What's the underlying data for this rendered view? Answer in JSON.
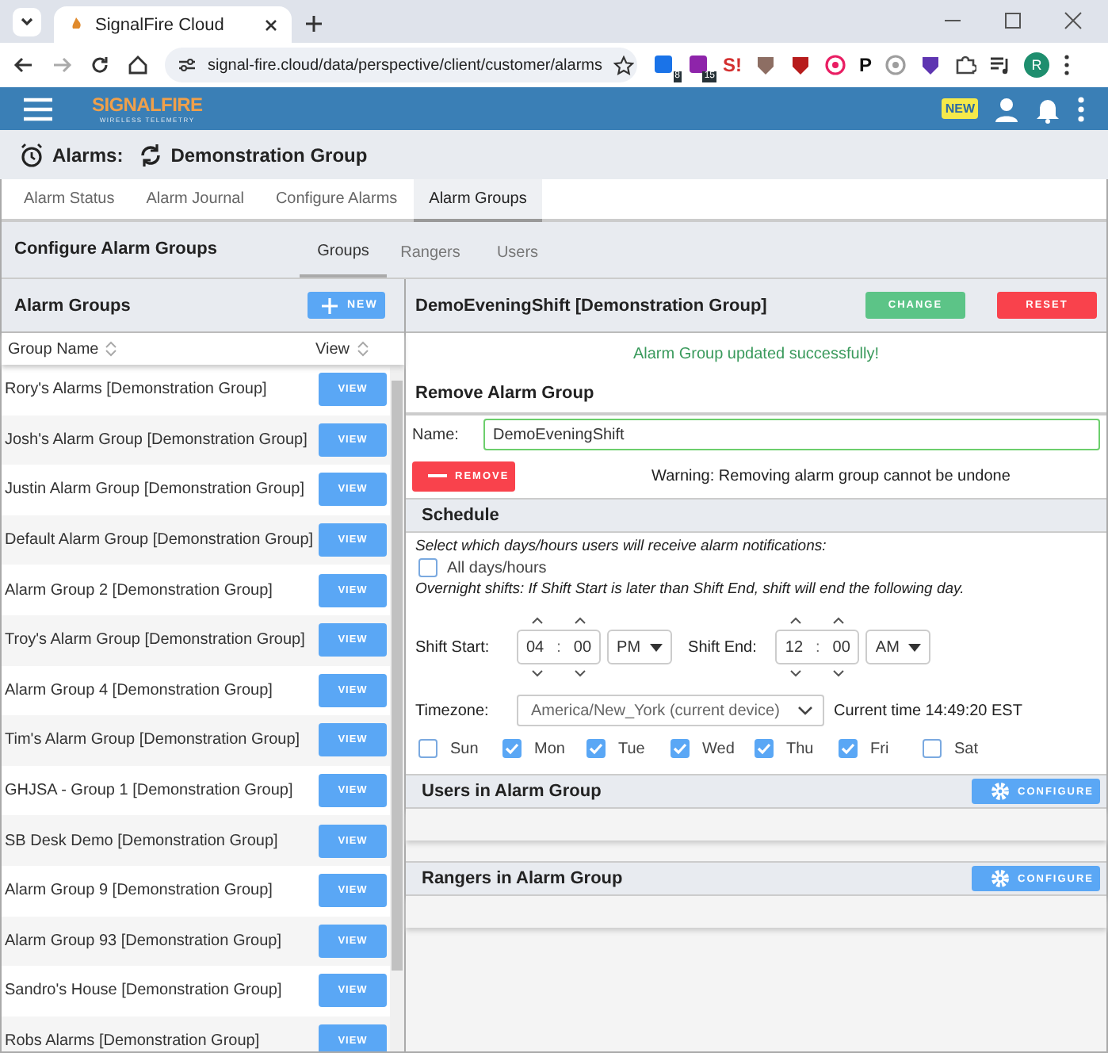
{
  "browser": {
    "tab_title": "SignalFire Cloud",
    "url": "signal-fire.cloud/data/perspective/client/customer/alarms",
    "extensions": [
      {
        "kind": "badge",
        "text": "8",
        "color": "#1a73e8"
      },
      {
        "kind": "badge",
        "text": "15",
        "color": "#8e24aa"
      },
      {
        "kind": "text",
        "text": "S!",
        "color": "#d32f2f"
      },
      {
        "kind": "shape",
        "color": "#8d6e63"
      },
      {
        "kind": "shape",
        "color": "#b71c1c"
      },
      {
        "kind": "circle",
        "color": "#e91e63"
      },
      {
        "kind": "text",
        "text": "P",
        "color": "#111111"
      },
      {
        "kind": "circle",
        "color": "#9e9e9e"
      },
      {
        "kind": "shape",
        "color": "#5e35b1"
      },
      {
        "kind": "puzzle",
        "color": "#444444"
      }
    ],
    "avatar": "R"
  },
  "app": {
    "logo": "SIGNALFIRE",
    "tagline": "WIRELESS TELEMETRY",
    "new_badge": "NEW"
  },
  "page_title": {
    "label": "Alarms:",
    "group": "Demonstration Group"
  },
  "tabs": [
    {
      "label": "Alarm Status",
      "selected": false
    },
    {
      "label": "Alarm Journal",
      "selected": false
    },
    {
      "label": "Configure Alarms",
      "selected": false
    },
    {
      "label": "Alarm Groups",
      "selected": true
    }
  ],
  "section_title": "Configure Alarm Groups",
  "subtabs": [
    {
      "label": "Groups",
      "selected": true
    },
    {
      "label": "Rangers",
      "selected": false
    },
    {
      "label": "Users",
      "selected": false
    }
  ],
  "left": {
    "title": "Alarm Groups",
    "new_button": "NEW",
    "columns": [
      "Group Name",
      "View"
    ],
    "rows": [
      {
        "name": "Rory's Alarms [Demonstration Group]",
        "button": "VIEW"
      },
      {
        "name": "Josh's Alarm Group [Demonstration Group]",
        "button": "VIEW"
      },
      {
        "name": "Justin Alarm Group [Demonstration Group]",
        "button": "VIEW"
      },
      {
        "name": "Default Alarm Group [Demonstration Group]",
        "button": "VIEW"
      },
      {
        "name": "Alarm Group 2 [Demonstration Group]",
        "button": "VIEW"
      },
      {
        "name": "Troy's Alarm Group [Demonstration Group]",
        "button": "VIEW"
      },
      {
        "name": "Alarm Group 4 [Demonstration Group]",
        "button": "VIEW"
      },
      {
        "name": "Tim's Alarm Group [Demonstration Group]",
        "button": "VIEW"
      },
      {
        "name": "GHJSA - Group 1 [Demonstration Group]",
        "button": "VIEW"
      },
      {
        "name": "SB Desk Demo [Demonstration Group]",
        "button": "VIEW"
      },
      {
        "name": "Alarm Group 9 [Demonstration Group]",
        "button": "VIEW"
      },
      {
        "name": "Alarm Group 93 [Demonstration Group]",
        "button": "VIEW"
      },
      {
        "name": "Sandro's House [Demonstration Group]",
        "button": "VIEW"
      },
      {
        "name": "Robs Alarms [Demonstration Group]",
        "button": "VIEW"
      }
    ]
  },
  "detail": {
    "title": "DemoEveningShift [Demonstration Group]",
    "change_button": "CHANGE",
    "reset_button": "RESET",
    "message": "Alarm Group updated successfully!",
    "remove_title": "Remove Alarm Group",
    "name_label": "Name:",
    "name_value": "DemoEveningShift",
    "remove_button": "REMOVE",
    "warning": "Warning: Removing alarm group cannot be undone",
    "schedule": {
      "title": "Schedule",
      "intro": "Select which days/hours users will receive alarm notifications:",
      "all_days": {
        "label": "All days/hours",
        "checked": false
      },
      "note": "Overnight shifts: If Shift Start is later than Shift End, shift will end the following day.",
      "start": {
        "label": "Shift Start:",
        "hour": "04",
        "separator": ":",
        "minute": "00",
        "ampm": "PM"
      },
      "end": {
        "label": "Shift End:",
        "hour": "12",
        "separator": ":",
        "minute": "00",
        "ampm": "AM"
      },
      "timezone_label": "Timezone:",
      "timezone": "America/New_York (current device)",
      "current_time": "Current time 14:49:20 EST",
      "days": [
        {
          "label": "Sun",
          "checked": false
        },
        {
          "label": "Mon",
          "checked": true
        },
        {
          "label": "Tue",
          "checked": true
        },
        {
          "label": "Wed",
          "checked": true
        },
        {
          "label": "Thu",
          "checked": true
        },
        {
          "label": "Fri",
          "checked": true
        },
        {
          "label": "Sat",
          "checked": false
        }
      ]
    },
    "users_title": "Users in Alarm Group",
    "users_configure_button": "CONFIGURE",
    "rangers_title": "Rangers in Alarm Group",
    "rangers_configure_button": "CONFIGURE"
  }
}
